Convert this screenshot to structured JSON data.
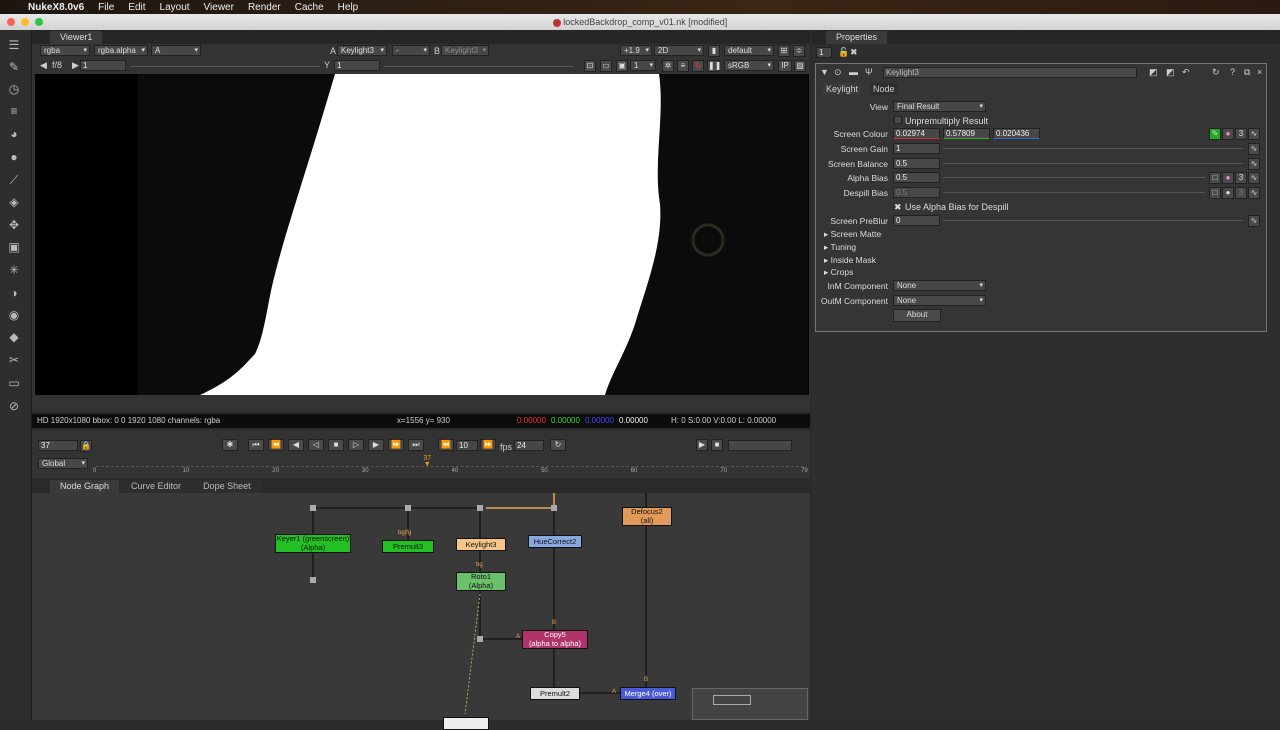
{
  "menubar": {
    "app": "NukeX8.0v6",
    "items": [
      "File",
      "Edit",
      "Layout",
      "Viewer",
      "Render",
      "Cache",
      "Help"
    ]
  },
  "window": {
    "title": "lockedBackdrop_comp_v01.nk [modified]"
  },
  "viewer": {
    "tab": "Viewer1",
    "channels": "rgba",
    "channel_alpha": "rgba.alpha",
    "mode": "A",
    "input_a_label": "A",
    "input_a": "Keylight3",
    "blend": "-",
    "input_b_label": "B",
    "input_b": "Keylight3",
    "gain_exposure": "+1.9",
    "view_mode": "2D",
    "lut": "default",
    "fstop": "f/8",
    "gain": "1",
    "gamma_label": "Y",
    "gamma": "1",
    "proxy": "1",
    "colorspace": "sRGB",
    "ip": "IP",
    "info": {
      "format": "HD 1920x1080 bbox: 0 0 1920 1080 channels: rgba",
      "coords": "x=1556 y= 930",
      "r": "0.00000",
      "g": "0.00000",
      "b": "0.00000",
      "a": "0.00000",
      "hsvl": "H:  0 S:0.00 V:0.00  L: 0.00000"
    }
  },
  "playback": {
    "frame": "37",
    "increment": "10",
    "fps_label": "fps",
    "fps": "24",
    "scope": "Global",
    "ticks": [
      "0",
      "10",
      "20",
      "30",
      "40",
      "50",
      "60",
      "70",
      "79"
    ],
    "current": "37",
    "end": "79",
    "current_fraction": 0.468
  },
  "nodegraph": {
    "tabs": [
      "Node Graph",
      "Curve Editor",
      "Dope Sheet"
    ],
    "nodes": {
      "keyer": "Keyer1 (greenscreen)",
      "keyer_sub": "(Alpha)",
      "premult3": "Premult3",
      "keylight": "Keylight3",
      "huecorrect": "HueCorrect2",
      "roto": "Roto1",
      "roto_sub": "(Alpha)",
      "defocus": "Defocus2",
      "defocus_sub": "(all)",
      "copy": "Copy5",
      "copy_sub": "(alpha to alpha)",
      "premult2": "Premult2",
      "merge": "Merge4 (over)"
    },
    "inputs": {
      "bgfg": "bg|fg",
      "bg": "bg",
      "a": "A",
      "b": "B",
      "a2": "A",
      "b2": "B"
    }
  },
  "properties": {
    "tab": "Properties",
    "max_panels": "1",
    "node_name": "Keylight3",
    "tabs": [
      "Keylight",
      "Node"
    ],
    "view_label": "View",
    "view": "Final Result",
    "unpremult": "Unpremultiply Result",
    "screen_colour_label": "Screen Colour",
    "screen_colour": [
      "0.02974",
      "0.57809",
      "0.020436"
    ],
    "screen_gain_label": "Screen Gain",
    "screen_gain": "1",
    "screen_balance_label": "Screen Balance",
    "screen_balance": "0.5",
    "alpha_bias_label": "Alpha Bias",
    "alpha_bias": "0.5",
    "despill_bias_label": "Despill Bias",
    "despill_bias": "0.5",
    "use_alpha_bias": "Use Alpha Bias for Despill",
    "preblur_label": "Screen PreBlur",
    "preblur": "0",
    "sections": [
      "Screen Matte",
      "Tuning",
      "Inside Mask",
      "Crops"
    ],
    "inm_label": "InM Component",
    "inm": "None",
    "outm_label": "OutM Component",
    "outm": "None",
    "about": "About",
    "channel_count": "3"
  }
}
